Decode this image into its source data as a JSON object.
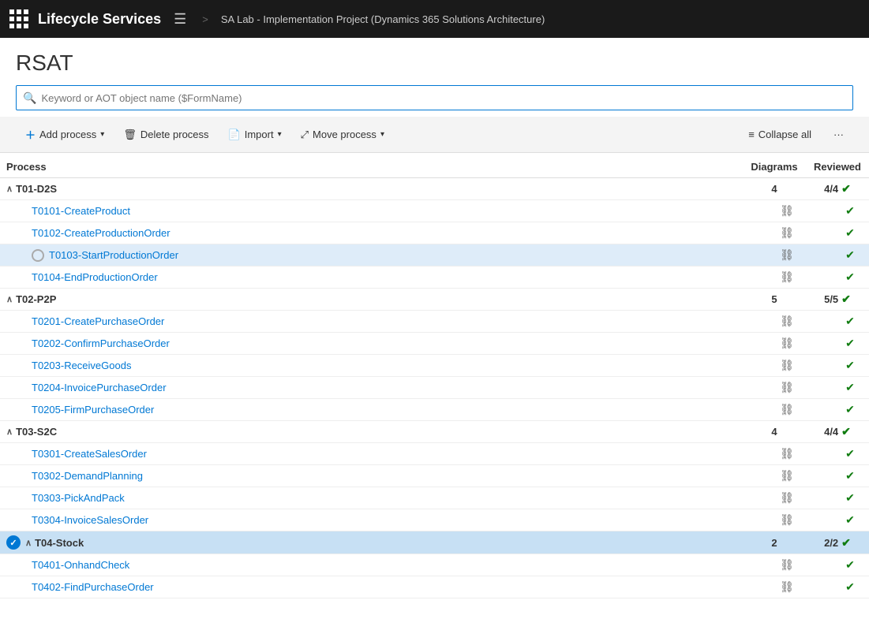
{
  "header": {
    "title": "Lifecycle Services",
    "breadcrumb": "SA Lab - Implementation Project (Dynamics 365 Solutions Architecture)"
  },
  "page": {
    "title": "RSAT"
  },
  "search": {
    "placeholder": "Keyword or AOT object name ($FormName)"
  },
  "toolbar": {
    "add_process": "Add process",
    "delete_process": "Delete process",
    "import": "Import",
    "move_process": "Move process",
    "collapse_all": "Collapse all"
  },
  "table": {
    "col_process": "Process",
    "col_diagrams": "Diagrams",
    "col_reviewed": "Reviewed"
  },
  "processes": [
    {
      "id": "T01-D2S",
      "label": "T01-D2S",
      "type": "group",
      "diagrams": "4",
      "reviewed": "4/4",
      "selected": false,
      "checked": false,
      "children": [
        {
          "id": "T0101",
          "label": "T0101-CreateProduct",
          "diagrams": "🖼",
          "reviewed": true,
          "selected": false
        },
        {
          "id": "T0102",
          "label": "T0102-CreateProductionOrder",
          "diagrams": "🖼",
          "reviewed": true,
          "selected": false
        },
        {
          "id": "T0103",
          "label": "T0103-StartProductionOrder",
          "diagrams": "🖼",
          "reviewed": true,
          "selected": true,
          "radio": true
        },
        {
          "id": "T0104",
          "label": "T0104-EndProductionOrder",
          "diagrams": "🖼",
          "reviewed": true,
          "selected": false
        }
      ]
    },
    {
      "id": "T02-P2P",
      "label": "T02-P2P",
      "type": "group",
      "diagrams": "5",
      "reviewed": "5/5",
      "selected": false,
      "checked": false,
      "children": [
        {
          "id": "T0201",
          "label": "T0201-CreatePurchaseOrder",
          "diagrams": "🖼",
          "reviewed": true,
          "selected": false
        },
        {
          "id": "T0202",
          "label": "T0202-ConfirmPurchaseOrder",
          "diagrams": "🖼",
          "reviewed": true,
          "selected": false
        },
        {
          "id": "T0203",
          "label": "T0203-ReceiveGoods",
          "diagrams": "🖼",
          "reviewed": true,
          "selected": false
        },
        {
          "id": "T0204",
          "label": "T0204-InvoicePurchaseOrder",
          "diagrams": "🖼",
          "reviewed": true,
          "selected": false
        },
        {
          "id": "T0205",
          "label": "T0205-FirmPurchaseOrder",
          "diagrams": "🖼",
          "reviewed": true,
          "selected": false
        }
      ]
    },
    {
      "id": "T03-S2C",
      "label": "T03-S2C",
      "type": "group",
      "diagrams": "4",
      "reviewed": "4/4",
      "selected": false,
      "checked": false,
      "children": [
        {
          "id": "T0301",
          "label": "T0301-CreateSalesOrder",
          "diagrams": "🖼",
          "reviewed": true,
          "selected": false
        },
        {
          "id": "T0302",
          "label": "T0302-DemandPlanning",
          "diagrams": "🖼",
          "reviewed": true,
          "selected": false
        },
        {
          "id": "T0303",
          "label": "T0303-PickAndPack",
          "diagrams": "🖼",
          "reviewed": true,
          "selected": false
        },
        {
          "id": "T0304",
          "label": "T0304-InvoiceSalesOrder",
          "diagrams": "🖼",
          "reviewed": true,
          "selected": false
        }
      ]
    },
    {
      "id": "T04-Stock",
      "label": "T04-Stock",
      "type": "group",
      "diagrams": "2",
      "reviewed": "2/2",
      "selected": true,
      "checked": true,
      "children": [
        {
          "id": "T0401",
          "label": "T0401-OnhandCheck",
          "diagrams": "🖼",
          "reviewed": true,
          "selected": false
        },
        {
          "id": "T0402",
          "label": "T0402-FindPurchaseOrder",
          "diagrams": "🖼",
          "reviewed": true,
          "selected": false
        }
      ]
    }
  ]
}
